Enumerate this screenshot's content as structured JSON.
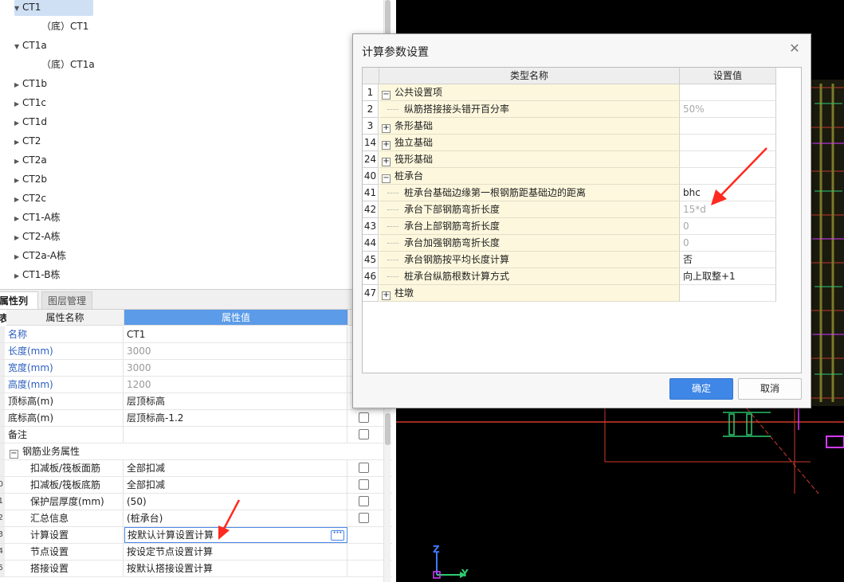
{
  "tree": {
    "items": [
      {
        "label": "CT1",
        "arrow": "▼",
        "selected": true
      },
      {
        "label": "（底）CT1",
        "arrow": ""
      },
      {
        "label": "CT1a",
        "arrow": "▼"
      },
      {
        "label": "（底）CT1a",
        "arrow": ""
      },
      {
        "label": "CT1b",
        "arrow": "▶"
      },
      {
        "label": "CT1c",
        "arrow": "▶"
      },
      {
        "label": "CT1d",
        "arrow": "▶"
      },
      {
        "label": "CT2",
        "arrow": "▶"
      },
      {
        "label": "CT2a",
        "arrow": "▶"
      },
      {
        "label": "CT2b",
        "arrow": "▶"
      },
      {
        "label": "CT2c",
        "arrow": "▶"
      },
      {
        "label": "CT1-A栋",
        "arrow": "▶"
      },
      {
        "label": "CT2-A栋",
        "arrow": "▶"
      },
      {
        "label": "CT2a-A栋",
        "arrow": "▶"
      },
      {
        "label": "CT1-B栋",
        "arrow": "▶"
      }
    ]
  },
  "props": {
    "tabs": [
      "属性列表",
      "图层管理"
    ],
    "header_name": "属性名称",
    "header_value": "属性值",
    "rows": [
      {
        "num": "",
        "name": "名称",
        "value": "CT1",
        "blue": true,
        "gray": false,
        "check": false
      },
      {
        "num": "",
        "name": "长度(mm)",
        "value": "3000",
        "blue": true,
        "gray": true,
        "check": false
      },
      {
        "num": "",
        "name": "宽度(mm)",
        "value": "3000",
        "blue": true,
        "gray": true,
        "check": false
      },
      {
        "num": "",
        "name": "高度(mm)",
        "value": "1200",
        "blue": true,
        "gray": true,
        "check": false
      },
      {
        "num": "",
        "name": "顶标高(m)",
        "value": "层顶标高",
        "blue": false,
        "gray": false,
        "check": false
      },
      {
        "num": "",
        "name": "底标高(m)",
        "value": "层顶标高-1.2",
        "blue": false,
        "gray": false,
        "check": true
      },
      {
        "num": "",
        "name": "备注",
        "value": "",
        "blue": false,
        "gray": false,
        "check": true
      },
      {
        "num": "",
        "name": "钢筋业务属性",
        "value": "",
        "blue": false,
        "gray": false,
        "check": false,
        "group": true
      },
      {
        "num": "",
        "name": "扣减板/筏板面筋",
        "value": "全部扣减",
        "blue": false,
        "gray": false,
        "check": true,
        "indent": true
      },
      {
        "num": "0",
        "name": "扣减板/筏板底筋",
        "value": "全部扣减",
        "blue": false,
        "gray": false,
        "check": true,
        "indent": true
      },
      {
        "num": "1",
        "name": "保护层厚度(mm)",
        "value": "(50)",
        "blue": false,
        "gray": false,
        "check": true,
        "indent": true
      },
      {
        "num": "2",
        "name": "汇总信息",
        "value": "(桩承台)",
        "blue": false,
        "gray": false,
        "check": true,
        "indent": true
      },
      {
        "num": "3",
        "name": "计算设置",
        "value": "按默认计算设置计算",
        "blue": false,
        "gray": false,
        "check": false,
        "indent": true,
        "editing": true
      },
      {
        "num": "4",
        "name": "节点设置",
        "value": "按设定节点设置计算",
        "blue": false,
        "gray": false,
        "check": false,
        "indent": true
      },
      {
        "num": "5",
        "name": "搭接设置",
        "value": "按默认搭接设置计算",
        "blue": false,
        "gray": false,
        "check": false,
        "indent": true
      }
    ],
    "ellipsis": "···"
  },
  "canvas": {
    "axis_z": "Z",
    "axis_y": "Y"
  },
  "dialog": {
    "title": "计算参数设置",
    "close": "✕",
    "col_name": "类型名称",
    "col_value": "设置值",
    "rows": [
      {
        "num": "1",
        "expander": "−",
        "name": "公共设置项",
        "value": "",
        "level": 0
      },
      {
        "num": "2",
        "expander": "",
        "name": "纵筋搭接接头错开百分率",
        "value": "50%",
        "level": 1,
        "gray": true
      },
      {
        "num": "3",
        "expander": "+",
        "name": "条形基础",
        "value": "",
        "level": 0
      },
      {
        "num": "14",
        "expander": "+",
        "name": "独立基础",
        "value": "",
        "level": 0
      },
      {
        "num": "24",
        "expander": "+",
        "name": "筏形基础",
        "value": "",
        "level": 0
      },
      {
        "num": "40",
        "expander": "−",
        "name": "桩承台",
        "value": "",
        "level": 0
      },
      {
        "num": "41",
        "expander": "",
        "name": "桩承台基础边缘第一根钢筋距基础边的距离",
        "value": "bhc",
        "level": 1
      },
      {
        "num": "42",
        "expander": "",
        "name": "承台下部钢筋弯折长度",
        "value": "15*d",
        "level": 1,
        "gray": true
      },
      {
        "num": "43",
        "expander": "",
        "name": "承台上部钢筋弯折长度",
        "value": "0",
        "level": 1,
        "gray": true
      },
      {
        "num": "44",
        "expander": "",
        "name": "承台加强钢筋弯折长度",
        "value": "0",
        "level": 1,
        "gray": true
      },
      {
        "num": "45",
        "expander": "",
        "name": "承台钢筋按平均长度计算",
        "value": "否",
        "level": 1
      },
      {
        "num": "46",
        "expander": "",
        "name": "桩承台纵筋根数计算方式",
        "value": "向上取整+1",
        "level": 1
      },
      {
        "num": "47",
        "expander": "+",
        "name": "柱墩",
        "value": "",
        "level": 0
      }
    ],
    "ok_label": "确定",
    "cancel_label": "取消"
  },
  "colors": {
    "accent": "#3f87e6",
    "selection": "#cfe0f5",
    "row_highlight": "#fdf8dd",
    "annotation_arrow": "#ff2a1f"
  }
}
